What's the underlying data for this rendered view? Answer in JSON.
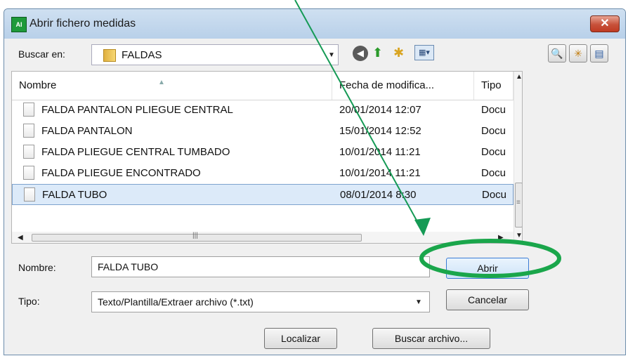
{
  "window": {
    "title": "Abrir fichero medidas",
    "app_icon_text": "AI",
    "close": "✕"
  },
  "lookin": {
    "label": "Buscar en:",
    "value": "FALDAS"
  },
  "columns": [
    "Nombre",
    "Fecha de modifica...",
    "Tipo"
  ],
  "files": [
    {
      "name": "FALDA PANTALON PLIEGUE CENTRAL",
      "date": "20/01/2014 12:07",
      "type": "Docu"
    },
    {
      "name": "FALDA PANTALON",
      "date": "15/01/2014 12:52",
      "type": "Docu"
    },
    {
      "name": "FALDA PLIEGUE CENTRAL TUMBADO",
      "date": "10/01/2014 11:21",
      "type": "Docu"
    },
    {
      "name": "FALDA PLIEGUE ENCONTRADO",
      "date": "10/01/2014 11:21",
      "type": "Docu"
    },
    {
      "name": "FALDA TUBO",
      "date": "08/01/2014 8:30",
      "type": "Docu"
    }
  ],
  "selected_file": "FALDA TUBO",
  "filename": {
    "label": "Nombre:",
    "value": "FALDA TUBO"
  },
  "filetype": {
    "label": "Tipo:",
    "value": "Texto/Plantilla/Extraer archivo (*.txt)"
  },
  "buttons": {
    "open": "Abrir",
    "cancel": "Cancelar",
    "locate": "Localizar",
    "search": "Buscar archivo..."
  },
  "scroll_glyphs": {
    "up": "▲",
    "down": "▼",
    "left": "◀",
    "right": "▶",
    "grip": "|||",
    "vgrip": "≡"
  },
  "annotation_colors": {
    "arrow": "#159a55",
    "ellipse": "#1aa64b"
  }
}
